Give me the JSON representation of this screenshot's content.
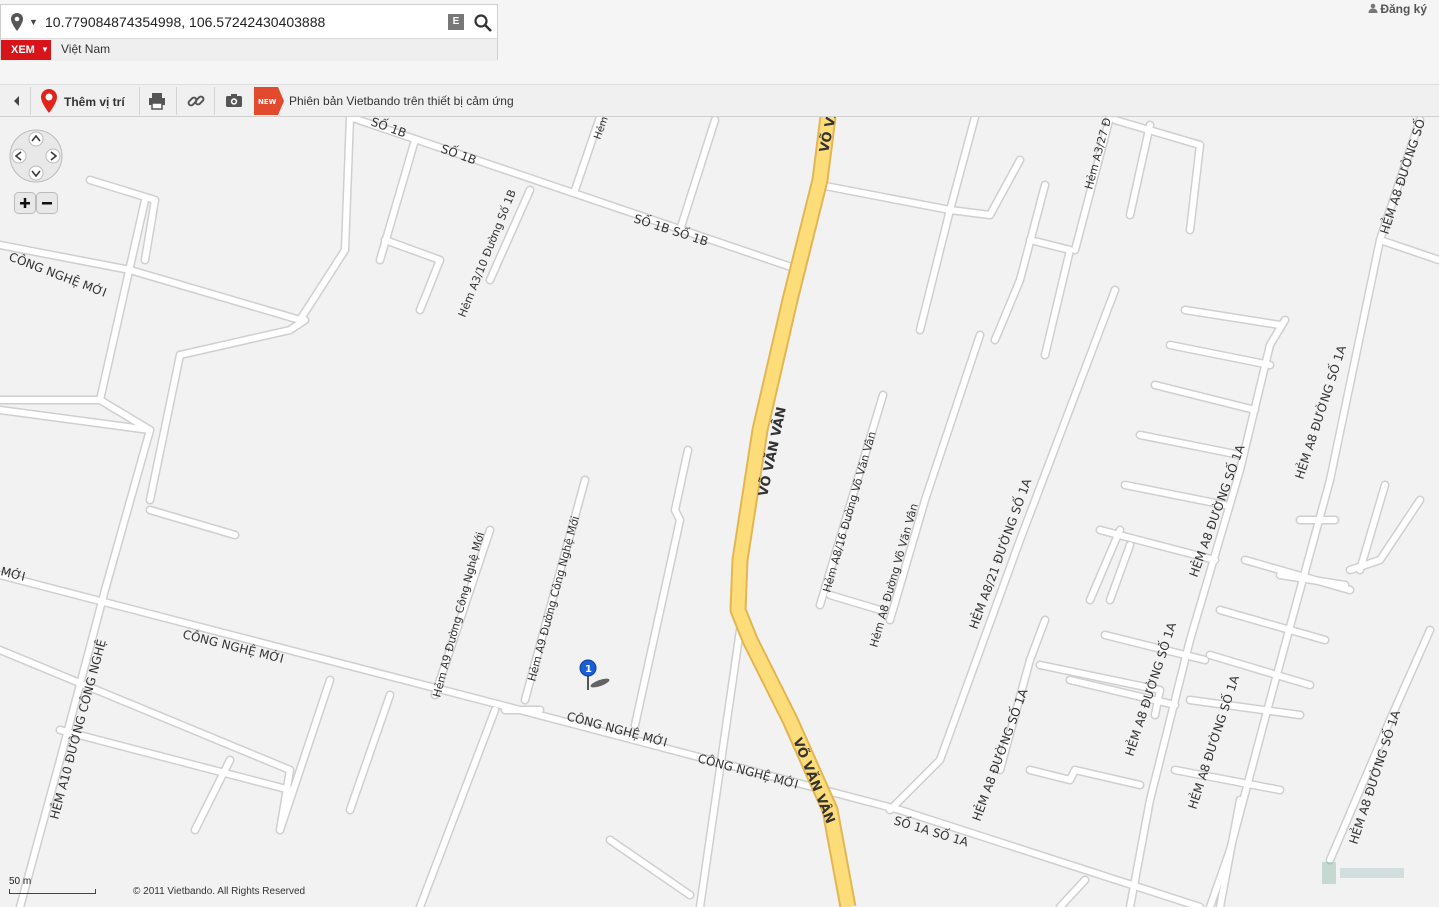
{
  "search": {
    "coordinates": "10.779084874354998, 106.57242430403888",
    "e_button": "E"
  },
  "region": {
    "view_button": "XEM",
    "country": "Việt Nam"
  },
  "account": {
    "register": "Đăng ký"
  },
  "toolbar": {
    "add_location": "Thêm vị trí",
    "new_badge": "NEW",
    "mobile_link": "Phiên bản Vietbando trên thiết bị cảm ứng"
  },
  "map": {
    "streets": {
      "so_1b_a": "SỐ 1B",
      "so_1b_b": "SỐ 1B",
      "so_1b_c": "SỐ 1B  SỐ 1B",
      "hem_top": "Hẻm",
      "hem_a3_10": "Hẻm A3/10 Đường Số 1B",
      "vo_van_van_top": "VÕ VĂN VÂN",
      "vo_van_van_mid": "VÕ VĂN VÂN",
      "vo_van_van_bottom": "VÕ VĂN VÂN",
      "hem_a3_27": "Hẻm A3/27 Đ",
      "hem_a8_so_top_right": "HẺM A8 ĐƯỜNG SỐ",
      "cong_nghe_moi_left": "CÔNG NGHỆ MỚI",
      "cong_nghe_moi_edge": "MỚI",
      "cong_nghe_moi_mid": "CÔNG NGHỆ MỚI",
      "cong_nghe_moi_bottom1": "CÔNG NGHỆ MỚI",
      "cong_nghe_moi_bottom2": "CÔNG NGHỆ MỚI",
      "hem_a10": "HẺM A10 ĐƯỜNG CÔNG NGHỆ",
      "hem_a9_1": "Hẻm A9 Đường Công Nghệ Mới",
      "hem_a9_2": "Hẻm A9 Đường Công Nghệ Mới",
      "hem_a8_16": "Hẻm A8/16 Đường Võ Văn Vân",
      "hem_a8_vvv": "Hẻm A8 Đường Võ Văn Vân",
      "hem_a8_21": "HẺM A8/21 ĐƯỜNG SỐ 1A",
      "hem_a8_1a_a": "HẺM A8 ĐƯỜNG SỐ 1A",
      "hem_a8_1a_b": "HẺM A8 ĐƯỜNG SỐ 1A",
      "hem_a8_1a_c": "HẺM A8 ĐƯỜNG SỐ 1A",
      "hem_a8_1a_d": "HẺM A8 ĐƯỜNG SỐ 1A",
      "hem_a8_1a_e": "HẺM A8 ĐƯỜNG SỐ 1A",
      "hem_a8_1a_f": "HẺM A8 ĐƯỜNG SỐ 1A",
      "so_1a": "SỐ 1A  SỐ 1A"
    },
    "marker_number": "1",
    "scale_label": "50 m",
    "copyright": "© 2011 Vietbando. All Rights Reserved",
    "colors": {
      "background": "#f2f2f2",
      "road": "#ffffff",
      "road_edge": "#cfcfcf",
      "main_road": "#fddc7a",
      "main_road_edge": "#e2b652",
      "marker": "#1a5fd6"
    }
  }
}
